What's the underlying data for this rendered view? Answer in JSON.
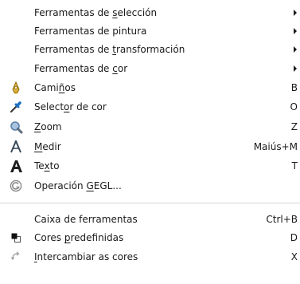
{
  "menu": {
    "submenus": [
      {
        "pre": "Ferramentas de ",
        "mn": "s",
        "post": "elección"
      },
      {
        "pre": "Ferramentas de pintura",
        "mn": "",
        "post": ""
      },
      {
        "pre": "Ferramentas de ",
        "mn": "t",
        "post": "ransformación"
      },
      {
        "pre": "Ferramentas de ",
        "mn": "c",
        "post": "or"
      }
    ],
    "tools": [
      {
        "pre": "Cami",
        "mn": "ñ",
        "post": "os",
        "accel": "B",
        "icon": "paths-icon"
      },
      {
        "pre": "Select",
        "mn": "o",
        "post": "r de cor",
        "accel": "O",
        "icon": "color-picker-icon"
      },
      {
        "pre": "",
        "mn": "Z",
        "post": "oom",
        "accel": "Z",
        "icon": "zoom-icon"
      },
      {
        "pre": "",
        "mn": "M",
        "post": "edir",
        "accel": "Maiús+M",
        "icon": "measure-icon"
      },
      {
        "pre": "Te",
        "mn": "x",
        "post": "to",
        "accel": "T",
        "icon": "text-icon"
      },
      {
        "pre": "Operación ",
        "mn": "G",
        "post": "EGL...",
        "accel": "",
        "icon": "gegl-icon"
      }
    ],
    "extras": [
      {
        "pre": "Caixa de ferramentas",
        "mn": "",
        "post": "",
        "accel": "Ctrl+B",
        "icon": ""
      },
      {
        "pre": "Cores ",
        "mn": "p",
        "post": "redefinidas",
        "accel": "D",
        "icon": "default-colors-icon"
      },
      {
        "pre": "",
        "mn": "I",
        "post": "ntercambiar as cores",
        "accel": "X",
        "icon": "swap-colors-icon"
      }
    ]
  },
  "colors": {
    "text": "#1a1a1a",
    "separator": "#d6d6d6",
    "paths_icon": "#e2b43a",
    "zoom_icon": "#7a9cc4"
  }
}
